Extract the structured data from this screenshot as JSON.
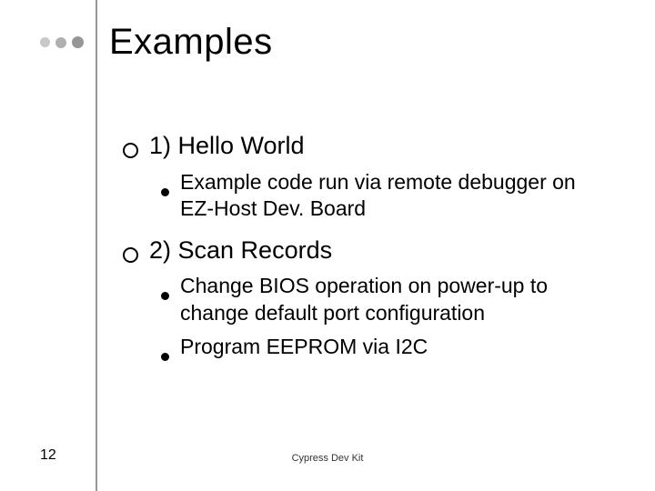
{
  "title": "Examples",
  "items": [
    {
      "label": "1) Hello World",
      "sub": [
        "Example code run via remote debugger on EZ-Host Dev. Board"
      ]
    },
    {
      "label": "2) Scan Records",
      "sub": [
        "Change BIOS operation on power-up to change default port configuration",
        "Program EEPROM via I2C"
      ]
    }
  ],
  "page_number": "12",
  "footer": "Cypress Dev Kit"
}
